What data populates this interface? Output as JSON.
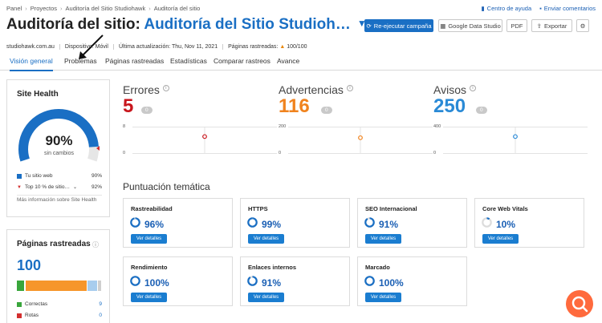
{
  "breadcrumb": [
    "Panel",
    "Proyectos",
    "Auditoría del Sitio Studiohawk",
    "Auditoría del sitio"
  ],
  "top_links": {
    "help": "Centro de ayuda",
    "feedback": "Enviar comentarios"
  },
  "title": {
    "prefix": "Auditoría del sitio: ",
    "project": "Auditoría del Sitio Studioh…"
  },
  "actions": {
    "rerun": "Re-ejecutar campaña",
    "gds": "Google Data Studio",
    "pdf": "PDF",
    "export": "Exportar"
  },
  "info": {
    "domain": "studiohawk.com.au",
    "device": "Dispositivo: Móvil",
    "updated": "Última actualización: Thu, Nov 11, 2021",
    "crawled_label": "Páginas rastreadas:",
    "crawled_value": "100/100"
  },
  "tabs": [
    "Visión general",
    "Problemas",
    "Páginas rastreadas",
    "Estadísticas",
    "Comparar rastreos",
    "Avance"
  ],
  "site_health": {
    "title": "Site Health",
    "value": "90%",
    "percent": 90,
    "sub": "sin cambios",
    "legend": [
      {
        "label": "Tu sitio web",
        "value": "90%"
      },
      {
        "label": "Top 10 % de sitio…",
        "value": "92%"
      }
    ],
    "more": "Más información sobre Site Health"
  },
  "crawled_pages": {
    "title": "Páginas rastreadas",
    "value": "100",
    "bar": [
      {
        "name": "Correctas",
        "fraction": 0.09,
        "color": "#39a63c"
      },
      {
        "name": "Rotas",
        "fraction": 0.01,
        "color": "#d32f2f"
      },
      {
        "name": "Con problemas",
        "fraction": 0.73,
        "color": "#f6962b"
      },
      {
        "name": "Redirigidas",
        "fraction": 0.12,
        "color": "#a8cdee"
      },
      {
        "name": "Bloqueadas",
        "fraction": 0.05,
        "color": "#cfcfcf"
      }
    ],
    "legend": [
      {
        "label": "Correctas",
        "value": "9"
      },
      {
        "label": "Rotas",
        "value": "0"
      }
    ]
  },
  "metrics": [
    {
      "label": "Errores",
      "value": "5",
      "pill": "0",
      "color": "#c8161d",
      "ymax": "8",
      "ymin": "0",
      "point": 5,
      "max": 8
    },
    {
      "label": "Advertencias",
      "value": "116",
      "pill": "0",
      "color": "#f0831e",
      "ymax": "200",
      "ymin": "0",
      "point": 116,
      "max": 200
    },
    {
      "label": "Avisos",
      "value": "250",
      "pill": "0",
      "color": "#2a8ad6",
      "ymax": "400",
      "ymin": "0",
      "point": 250,
      "max": 400
    }
  ],
  "thematic": {
    "title": "Puntuación temática",
    "button": "Ver detalles",
    "cards": [
      {
        "name": "Rastreabilidad",
        "value": "96%",
        "pct": 96
      },
      {
        "name": "HTTPS",
        "value": "99%",
        "pct": 99
      },
      {
        "name": "SEO Internacional",
        "value": "91%",
        "pct": 91
      },
      {
        "name": "Core Web Vitals",
        "value": "10%",
        "pct": 10
      },
      {
        "name": "Rendimiento",
        "value": "100%",
        "pct": 100
      },
      {
        "name": "Enlaces internos",
        "value": "91%",
        "pct": 91
      },
      {
        "name": "Marcado",
        "value": "100%",
        "pct": 100
      }
    ]
  }
}
